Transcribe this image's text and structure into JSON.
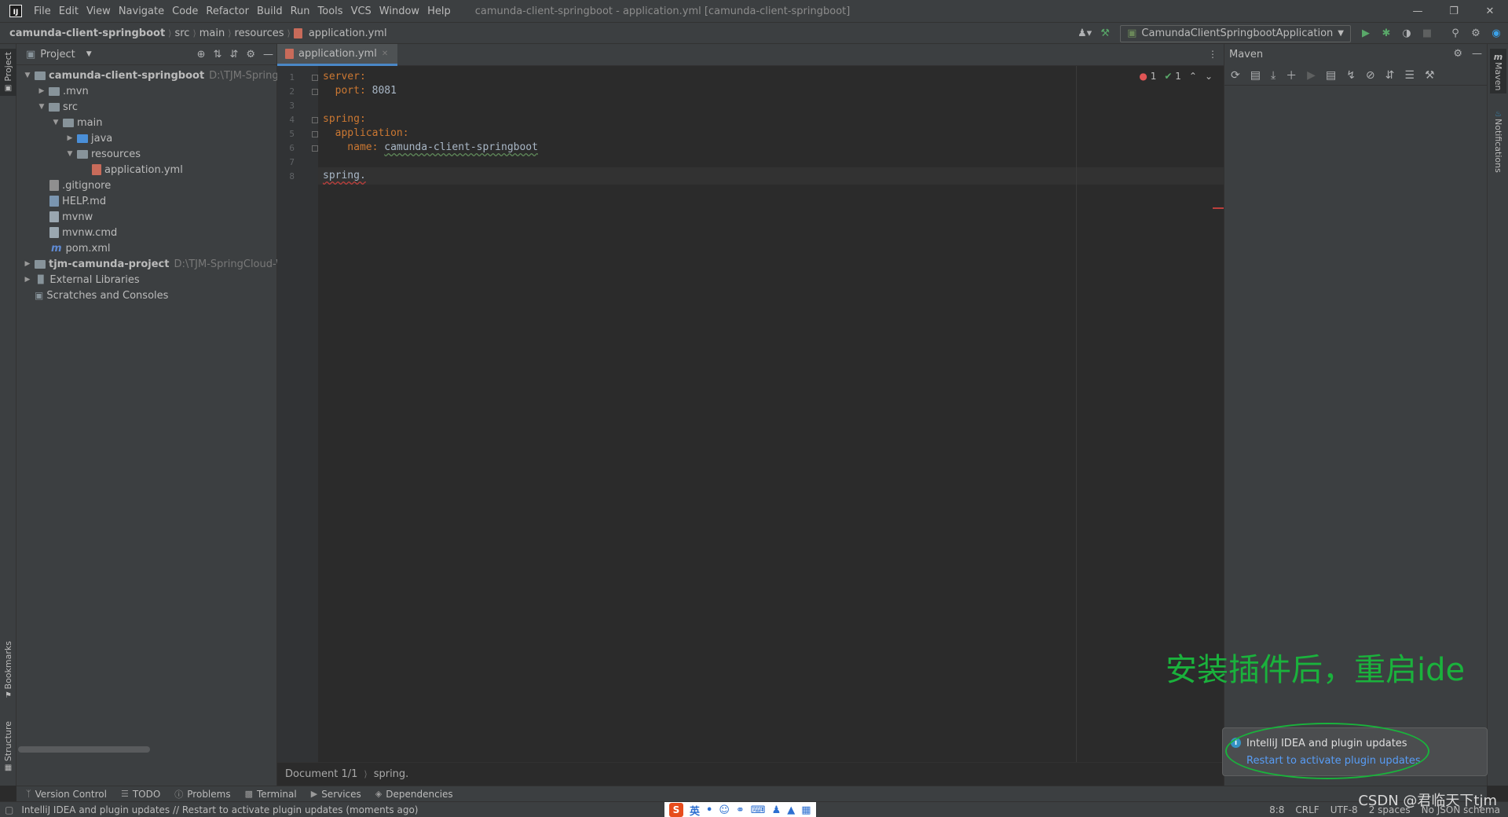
{
  "menubar": {
    "logo": "IJ",
    "items": [
      "File",
      "Edit",
      "View",
      "Navigate",
      "Code",
      "Refactor",
      "Build",
      "Run",
      "Tools",
      "VCS",
      "Window",
      "Help"
    ],
    "window_title": "camunda-client-springboot - application.yml [camunda-client-springboot]"
  },
  "navbar": {
    "breadcrumbs": [
      "camunda-client-springboot",
      "src",
      "main",
      "resources",
      "application.yml"
    ],
    "run_config": "CamundaClientSpringbootApplication"
  },
  "left_strip": {
    "project_tab": "Project",
    "bookmarks_tab": "Bookmarks",
    "structure_tab": "Structure"
  },
  "project": {
    "title": "Project",
    "tree": [
      {
        "label": "camunda-client-springboot",
        "path": "D:\\TJM-SpringCloud",
        "level": 0,
        "arrow": "v",
        "type": "module"
      },
      {
        "label": ".mvn",
        "level": 1,
        "arrow": ">",
        "type": "folder"
      },
      {
        "label": "src",
        "level": 1,
        "arrow": "v",
        "type": "folder"
      },
      {
        "label": "main",
        "level": 2,
        "arrow": "v",
        "type": "folder"
      },
      {
        "label": "java",
        "level": 3,
        "arrow": ">",
        "type": "folder-blue"
      },
      {
        "label": "resources",
        "level": 3,
        "arrow": "v",
        "type": "folder"
      },
      {
        "label": "application.yml",
        "level": 4,
        "arrow": "",
        "type": "yml"
      },
      {
        "label": ".gitignore",
        "level": 1,
        "arrow": "",
        "type": "git"
      },
      {
        "label": "HELP.md",
        "level": 1,
        "arrow": "",
        "type": "md"
      },
      {
        "label": "mvnw",
        "level": 1,
        "arrow": "",
        "type": "file"
      },
      {
        "label": "mvnw.cmd",
        "level": 1,
        "arrow": "",
        "type": "file"
      },
      {
        "label": "pom.xml",
        "level": 1,
        "arrow": "",
        "type": "pom"
      },
      {
        "label": "tjm-camunda-project",
        "path": "D:\\TJM-SpringCloud-Work",
        "level": 0,
        "arrow": ">",
        "type": "module"
      },
      {
        "label": "External Libraries",
        "level": 0,
        "arrow": ">",
        "type": "lib"
      },
      {
        "label": "Scratches and Consoles",
        "level": 0,
        "arrow": "",
        "type": "scratch"
      }
    ]
  },
  "editor": {
    "tab_label": "application.yml",
    "line_numbers": [
      "1",
      "2",
      "3",
      "4",
      "5",
      "6",
      "7",
      "8"
    ],
    "lines": [
      {
        "key": "server",
        "sep": ":",
        "val": ""
      },
      {
        "key": "  port",
        "sep": ": ",
        "val": "8081"
      },
      {
        "key": "",
        "sep": "",
        "val": ""
      },
      {
        "key": "spring",
        "sep": ":",
        "val": ""
      },
      {
        "key": "  application",
        "sep": ":",
        "val": ""
      },
      {
        "key": "    name",
        "sep": ": ",
        "val": "camunda-client-springboot"
      },
      {
        "key": "",
        "sep": "",
        "val": ""
      },
      {
        "key": "",
        "sep": "",
        "val": "spring."
      }
    ],
    "errors_count": "1",
    "warnings_count": "1",
    "breadcrumb_doc": "Document 1/1",
    "breadcrumb_path": "spring."
  },
  "maven": {
    "title": "Maven"
  },
  "right_strip": {
    "maven_tab": "Maven",
    "notifications_tab": "Notifications"
  },
  "annotation": "安装插件后，重启ide",
  "notification": {
    "title": "IntelliJ IDEA and plugin updates",
    "action": "Restart to activate plugin updates"
  },
  "bottom_tools": [
    "Version Control",
    "TODO",
    "Problems",
    "Terminal",
    "Services",
    "Dependencies"
  ],
  "statusbar": {
    "message": "IntelliJ IDEA and plugin updates // Restart to activate plugin updates (moments ago)",
    "position": "8:8",
    "line_sep": "CRLF",
    "encoding": "UTF-8",
    "indent": "2 spaces",
    "schema": "No JSON schema",
    "ime_label": "英"
  },
  "watermark": "CSDN @君临天下tjm",
  "colors": {
    "accent": "#4a88c7",
    "annotation": "#1ab23c",
    "link": "#589df6"
  }
}
